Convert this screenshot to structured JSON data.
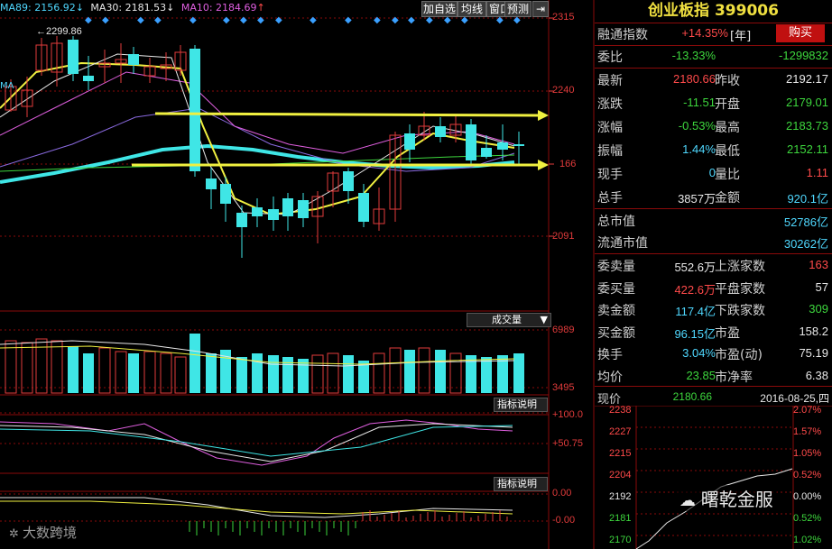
{
  "header": {
    "ma89_label": "MA89: 2156.92",
    "ma89_arrow": "↓",
    "ma30_label": "MA30: 2181.53",
    "ma30_arrow": "↓",
    "ma10_label": "MA10: 2184.69",
    "ma10_arrow": "↑",
    "buttons": [
      "加自选",
      "均线",
      "窗口",
      "预测"
    ]
  },
  "main_chart": {
    "price_axis": [
      "2315",
      "2240",
      "166",
      "2091"
    ],
    "high_marker": "2299.86",
    "left_stub": "MA"
  },
  "volume_panel": {
    "title": "成交量",
    "axis": [
      "6989",
      "3495"
    ]
  },
  "indicator1": {
    "title": "指标说明",
    "axis": [
      "+100.0",
      "+50.75"
    ]
  },
  "indicator2": {
    "title": "指标说明",
    "axis": [
      "0.00",
      "-0.00"
    ]
  },
  "quote": {
    "title": "创业板指 399006",
    "rongtong_label": "融通指数",
    "rongtong_value": "+14.35%",
    "rongtong_unit": "[年]",
    "buy_button": "购买",
    "weibi_label": "委比",
    "weibi_value": "-13.33%",
    "weibi_diff": "-1299832",
    "rows": [
      {
        "l1": "最新",
        "v1": "2180.66",
        "c1": "red",
        "l2": "昨收",
        "v2": "2192.17",
        "c2": "wht"
      },
      {
        "l1": "涨跌",
        "v1": "-11.51",
        "c1": "grn",
        "l2": "开盘",
        "v2": "2179.01",
        "c2": "grn"
      },
      {
        "l1": "涨幅",
        "v1": "-0.53%",
        "c1": "grn",
        "l2": "最高",
        "v2": "2183.73",
        "c2": "grn"
      },
      {
        "l1": "振幅",
        "v1": "1.44%",
        "c1": "cyan",
        "l2": "最低",
        "v2": "2152.11",
        "c2": "grn"
      },
      {
        "l1": "现手",
        "v1": "0",
        "c1": "cyan",
        "l2": "量比",
        "v2": "1.11",
        "c2": "red"
      },
      {
        "l1": "总手",
        "v1": "3857万",
        "c1": "wht",
        "l2": "金额",
        "v2": "920.1亿",
        "c2": "cyan"
      }
    ],
    "market_cap_rows": [
      {
        "label": "总市值",
        "value": "52786亿"
      },
      {
        "label": "流通市值",
        "value": "30262亿"
      }
    ],
    "order_rows": [
      {
        "l1": "委卖量",
        "v1": "552.6万",
        "c1": "wht",
        "l2": "上涨家数",
        "v2": "163",
        "c2": "red"
      },
      {
        "l1": "委买量",
        "v1": "422.6万",
        "c1": "red",
        "l2": "平盘家数",
        "v2": "57",
        "c2": "wht"
      },
      {
        "l1": "卖金额",
        "v1": "117.4亿",
        "c1": "cyan",
        "l2": "下跌家数",
        "v2": "309",
        "c2": "grn"
      },
      {
        "l1": "买金额",
        "v1": "96.15亿",
        "c1": "cyan",
        "l2": "市盈",
        "v2": "158.2",
        "c2": "wht"
      },
      {
        "l1": "换手",
        "v1": "3.04%",
        "c1": "cyan",
        "l2": "市盈(动)",
        "v2": "75.19",
        "c2": "wht"
      },
      {
        "l1": "均价",
        "v1": "23.85",
        "c1": "grn",
        "l2": "市净率",
        "v2": "6.38",
        "c2": "wht"
      }
    ],
    "current_label": "现价",
    "current_value": "2180.66",
    "date": "2016-08-25,四"
  },
  "mini_chart": {
    "left_axis": [
      "2238",
      "2227",
      "2215",
      "2204",
      "2192",
      "2181",
      "2170"
    ],
    "right_axis": [
      "2.07%",
      "1.57%",
      "1.05%",
      "0.52%",
      "0.00%",
      "0.52%",
      "1.02%"
    ]
  },
  "watermarks": {
    "bottom_left": "大数跨境",
    "bottom_right": "曙乾金服"
  },
  "colors": {
    "up": "#e23b3b",
    "down": "#3fe6e6",
    "ma_yellow": "#f0f040",
    "grid_red": "#8a0a0a"
  }
}
